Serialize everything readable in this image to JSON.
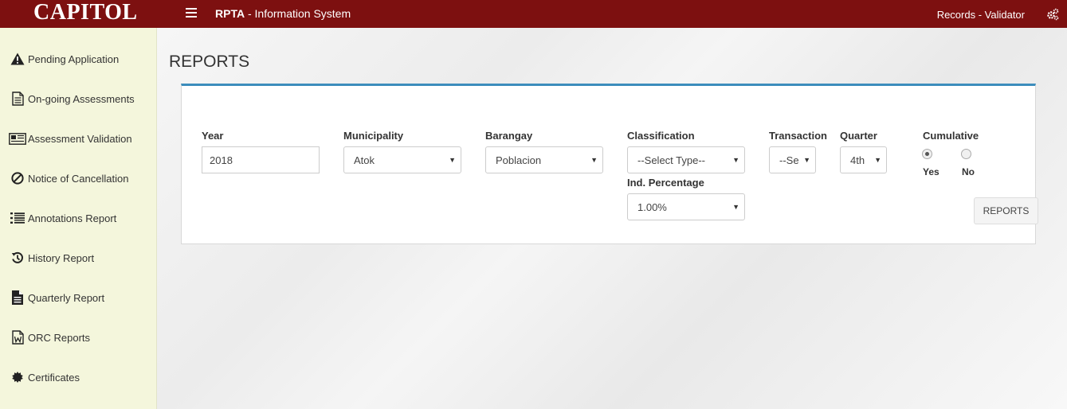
{
  "header": {
    "brand": "CAPITOL",
    "app_title_bold": "RPTA",
    "app_title_rest": " - Information System",
    "user_role": "Records - Validator",
    "bar_color": "#7d1010"
  },
  "sidebar": {
    "items": [
      {
        "label": "Pending Application",
        "icon": "warning-icon"
      },
      {
        "label": "On-going Assessments",
        "icon": "document-icon"
      },
      {
        "label": "Assessment Validation",
        "icon": "newspaper-icon"
      },
      {
        "label": "Notice of Cancellation",
        "icon": "ban-icon"
      },
      {
        "label": "Annotations Report",
        "icon": "list-icon"
      },
      {
        "label": "History Report",
        "icon": "history-icon"
      },
      {
        "label": "Quarterly Report",
        "icon": "file-text-icon"
      },
      {
        "label": "ORC Reports",
        "icon": "word-file-icon"
      },
      {
        "label": "Certificates",
        "icon": "certificate-icon"
      }
    ]
  },
  "main": {
    "title": "REPORTS",
    "form": {
      "year_label": "Year",
      "year_value": "2018",
      "municipality_label": "Municipality",
      "municipality_value": "Atok",
      "barangay_label": "Barangay",
      "barangay_value": "Poblacion",
      "classification_label": "Classification",
      "classification_value": "--Select Type--",
      "transaction_label": "Transaction",
      "transaction_value": "--Se",
      "quarter_label": "Quarter",
      "quarter_value": "4th",
      "cumulative_label": "Cumulative",
      "cumulative_yes": "Yes",
      "cumulative_no": "No",
      "cumulative_selected": "Yes",
      "ind_percentage_label": "Ind. Percentage",
      "ind_percentage_value": "1.00%",
      "reports_button": "REPORTS"
    },
    "accent_color": "#3c8dbc"
  }
}
